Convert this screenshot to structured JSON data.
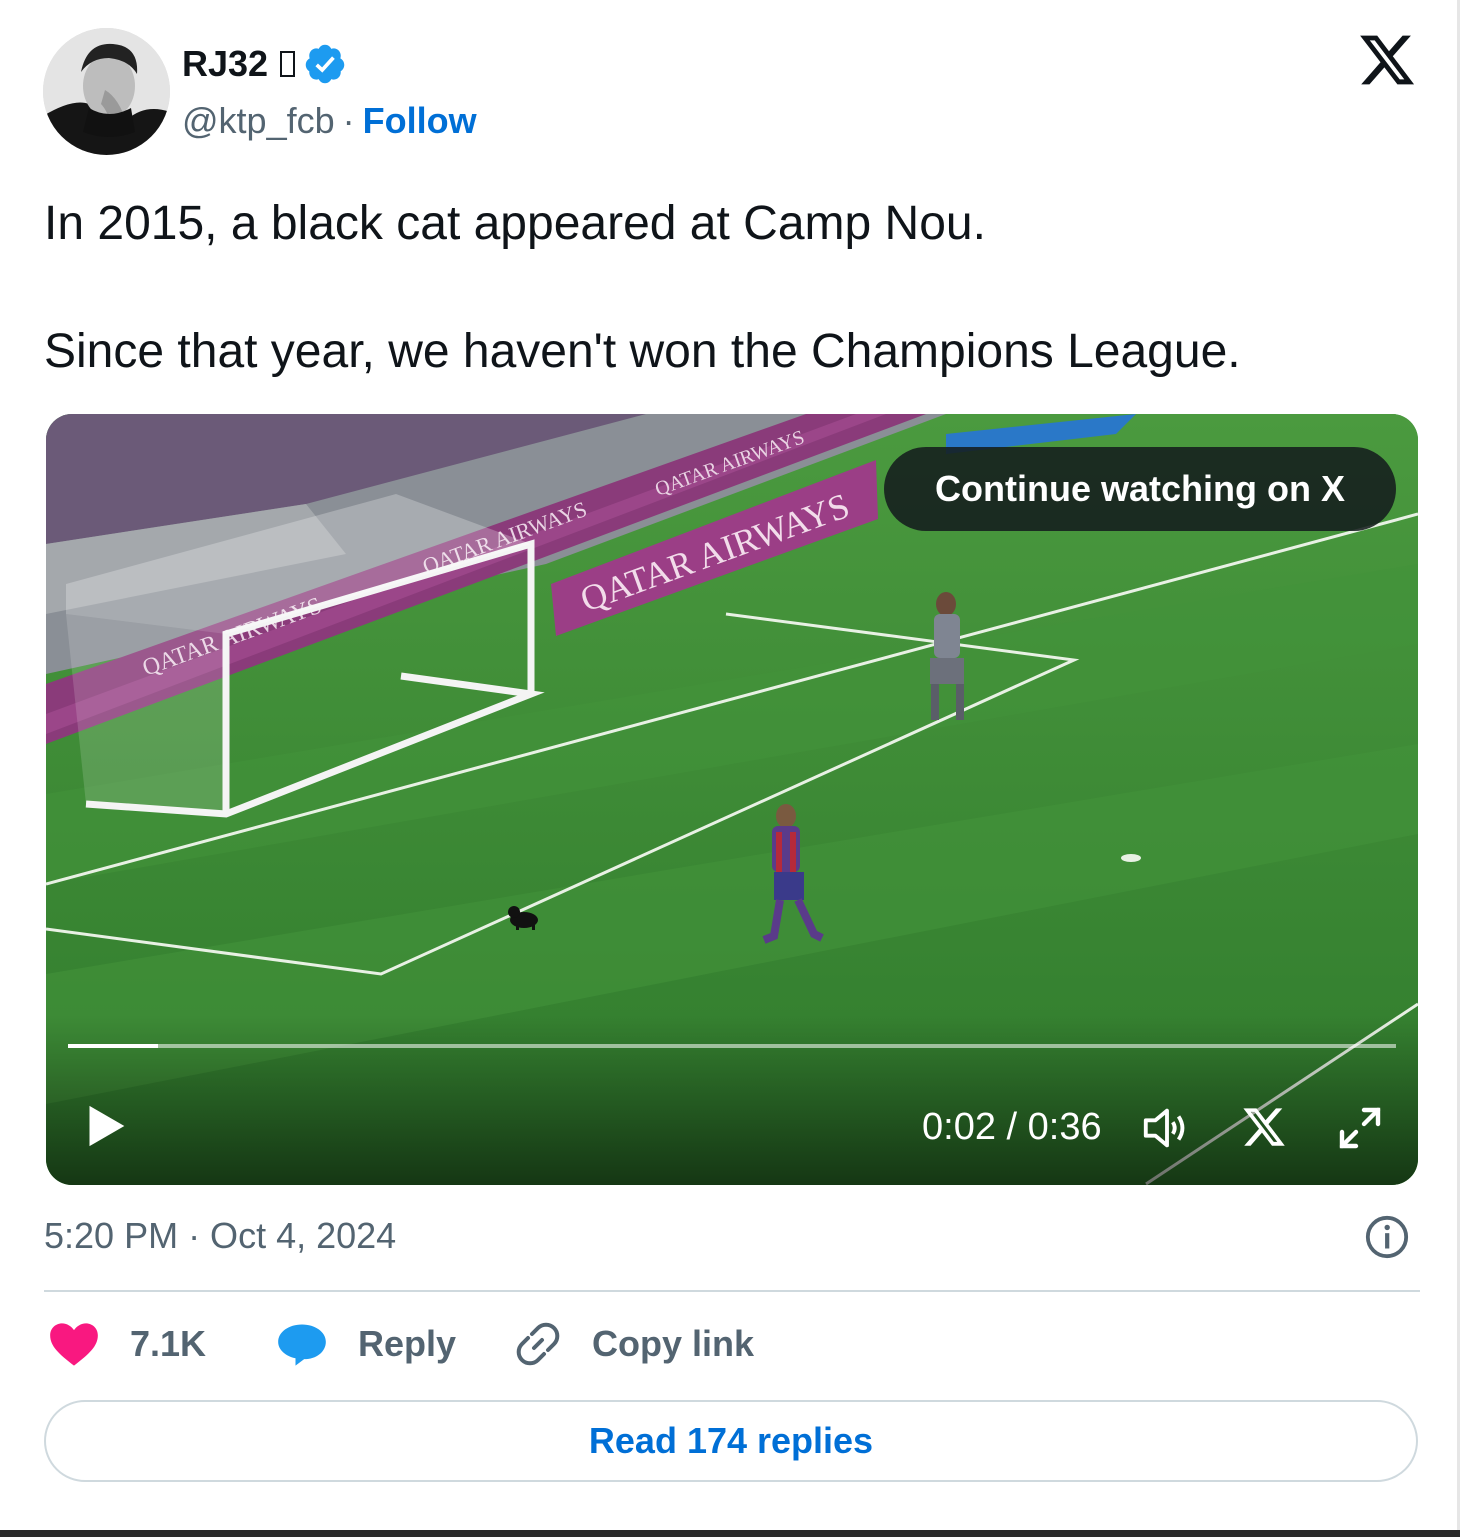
{
  "author": {
    "display_name": "RJ32",
    "handle": "@ktp_fcb",
    "separator": "·",
    "follow_label": "Follow",
    "verified": true
  },
  "platform_icon": "x-logo-icon",
  "tweet": {
    "paragraphs": [
      "In 2015, a black cat appeared at Camp Nou.",
      "Since that year, we haven't won the Champions League."
    ]
  },
  "video": {
    "continue_label": "Continue watching on X",
    "current_time": "0:02",
    "duration": "0:36",
    "time_display": "0:02 / 0:36",
    "progress_fraction": 0.068,
    "controls": [
      "play-icon",
      "volume-icon",
      "x-logo-icon",
      "fullscreen-icon"
    ],
    "scene_ads": [
      "QATAR AIRWAYS"
    ]
  },
  "meta": {
    "timestamp": "5:20 PM · Oct 4, 2024"
  },
  "actions": {
    "like_count": "7.1K",
    "reply_label": "Reply",
    "copy_label": "Copy link"
  },
  "read_replies_label": "Read 174 replies",
  "colors": {
    "link_blue": "#006fd6",
    "verified_blue": "#1d9bf0",
    "like_pink": "#f91880",
    "muted_gray": "#536471"
  }
}
